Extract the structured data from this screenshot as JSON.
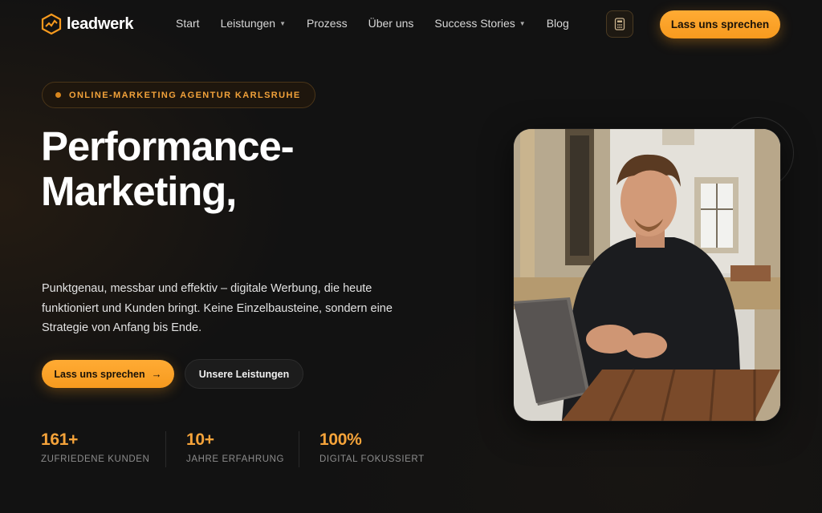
{
  "brand": {
    "name": "leadwerk",
    "accent": "#f79a1e"
  },
  "nav": {
    "items": [
      {
        "label": "Start",
        "dropdown": false
      },
      {
        "label": "Leistungen",
        "dropdown": true
      },
      {
        "label": "Prozess",
        "dropdown": false
      },
      {
        "label": "Über uns",
        "dropdown": false
      },
      {
        "label": "Success Stories",
        "dropdown": true
      },
      {
        "label": "Blog",
        "dropdown": false
      }
    ],
    "cta_label": "Lass uns sprechen",
    "calculator_icon": "calculator-icon"
  },
  "hero": {
    "badge": "ONLINE-MARKETING AGENTUR KARLSRUHE",
    "headline_line1": "Performance-",
    "headline_line2": "Marketing,",
    "lead": "Punktgenau, messbar und effektiv – digitale Werbung, die heute funktioniert und Kunden bringt. Keine Einzelbausteine, sondern eine Strategie von Anfang bis Ende.",
    "primary_button": "Lass uns sprechen",
    "primary_arrow": "→",
    "secondary_button": "Unsere Leistungen",
    "photo_alt_icon": "portrait-photo"
  },
  "stats": [
    {
      "value": "161+",
      "label": "ZUFRIEDENE KUNDEN"
    },
    {
      "value": "10+",
      "label": "JAHRE ERFAHRUNG"
    },
    {
      "value": "100%",
      "label": "DIGITAL FOKUSSIERT"
    }
  ]
}
